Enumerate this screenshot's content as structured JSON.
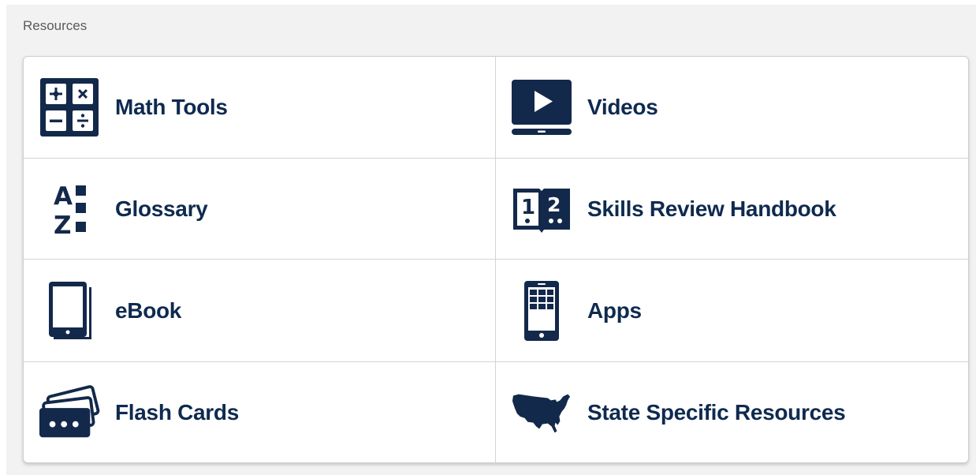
{
  "section": {
    "title": "Resources"
  },
  "colors": {
    "icon": "#13294b",
    "label": "#0f2a4f",
    "panel_bg": "#f2f2f2"
  },
  "resources": [
    {
      "label": "Math Tools",
      "icon": "calculator-grid-icon"
    },
    {
      "label": "Videos",
      "icon": "video-play-icon"
    },
    {
      "label": "Glossary",
      "icon": "a-z-list-icon"
    },
    {
      "label": "Skills Review Handbook",
      "icon": "numbered-book-icon"
    },
    {
      "label": "eBook",
      "icon": "tablet-icon"
    },
    {
      "label": "Apps",
      "icon": "phone-apps-icon"
    },
    {
      "label": "Flash Cards",
      "icon": "flash-cards-icon"
    },
    {
      "label": "State Specific Resources",
      "icon": "usa-map-icon"
    }
  ]
}
